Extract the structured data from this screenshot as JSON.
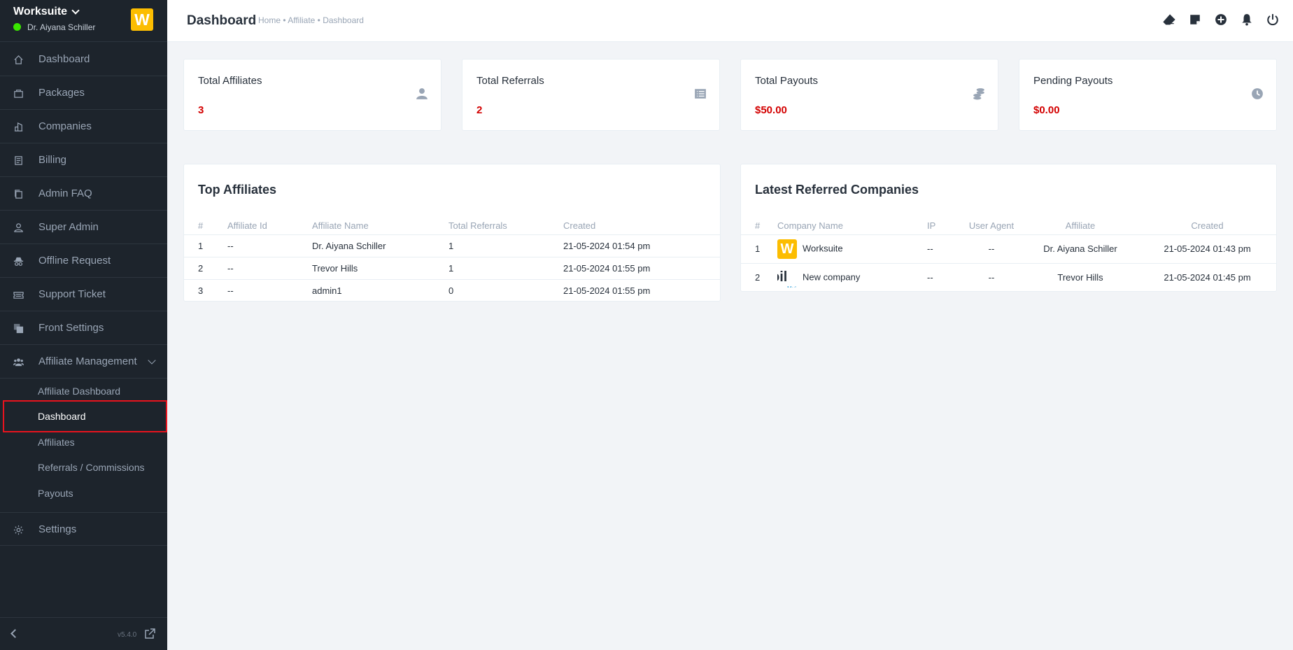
{
  "sidebar": {
    "brand": "Worksuite",
    "user": "Dr. Aiyana Schiller",
    "logo_letter": "W",
    "items": [
      {
        "label": "Dashboard",
        "icon": "house-icon"
      },
      {
        "label": "Packages",
        "icon": "bag-icon"
      },
      {
        "label": "Companies",
        "icon": "building-icon"
      },
      {
        "label": "Billing",
        "icon": "receipt-icon"
      },
      {
        "label": "Admin FAQ",
        "icon": "copy-icon"
      },
      {
        "label": "Super Admin",
        "icon": "person-icon"
      },
      {
        "label": "Offline Request",
        "icon": "incognito-icon"
      },
      {
        "label": "Support Ticket",
        "icon": "ticket-icon"
      },
      {
        "label": "Front Settings",
        "icon": "layers-icon"
      },
      {
        "label": "Affiliate Management",
        "icon": "people-icon"
      }
    ],
    "sub_items": [
      {
        "label": "Affiliate Dashboard"
      },
      {
        "label": "Dashboard"
      },
      {
        "label": "Affiliates"
      },
      {
        "label": "Referrals / Commissions"
      },
      {
        "label": "Payouts"
      }
    ],
    "settings_label": "Settings",
    "version": "v5.4.0"
  },
  "header": {
    "title": "Dashboard",
    "breadcrumb": "Home • Affiliate • Dashboard"
  },
  "stats": [
    {
      "label": "Total Affiliates",
      "value": "3",
      "icon": "person-icon"
    },
    {
      "label": "Total Referrals",
      "value": "2",
      "icon": "list-icon"
    },
    {
      "label": "Total Payouts",
      "value": "$50.00",
      "icon": "coins-icon"
    },
    {
      "label": "Pending Payouts",
      "value": "$0.00",
      "icon": "clock-icon"
    }
  ],
  "top_affiliates": {
    "title": "Top Affiliates",
    "columns": [
      "#",
      "Affiliate Id",
      "Affiliate Name",
      "Total Referrals",
      "Created"
    ],
    "rows": [
      [
        "1",
        "--",
        "Dr. Aiyana Schiller",
        "1",
        "21-05-2024 01:54 pm"
      ],
      [
        "2",
        "--",
        "Trevor Hills",
        "1",
        "21-05-2024 01:55 pm"
      ],
      [
        "3",
        "--",
        "admin1",
        "0",
        "21-05-2024 01:55 pm"
      ]
    ]
  },
  "latest_companies": {
    "title": "Latest Referred Companies",
    "columns": [
      "#",
      "Company Name",
      "IP",
      "User Agent",
      "Affiliate",
      "Created"
    ],
    "rows": [
      [
        "1",
        "Worksuite",
        "--",
        "--",
        "Dr. Aiyana Schiller",
        "21-05-2024 01:43 pm"
      ],
      [
        "2",
        "New company",
        "--",
        "--",
        "Trevor Hills",
        "21-05-2024 01:45 pm"
      ]
    ],
    "logos": [
      {
        "text": "W",
        "sub": ""
      },
      {
        "text": "oil",
        "sub": "Mul"
      }
    ]
  },
  "colors": {
    "sidebar_bg": "#1d242c",
    "accent_red": "#d30000",
    "brand_yellow": "#fcbd01",
    "online_green": "#39e500",
    "highlight": "#e8131e"
  }
}
